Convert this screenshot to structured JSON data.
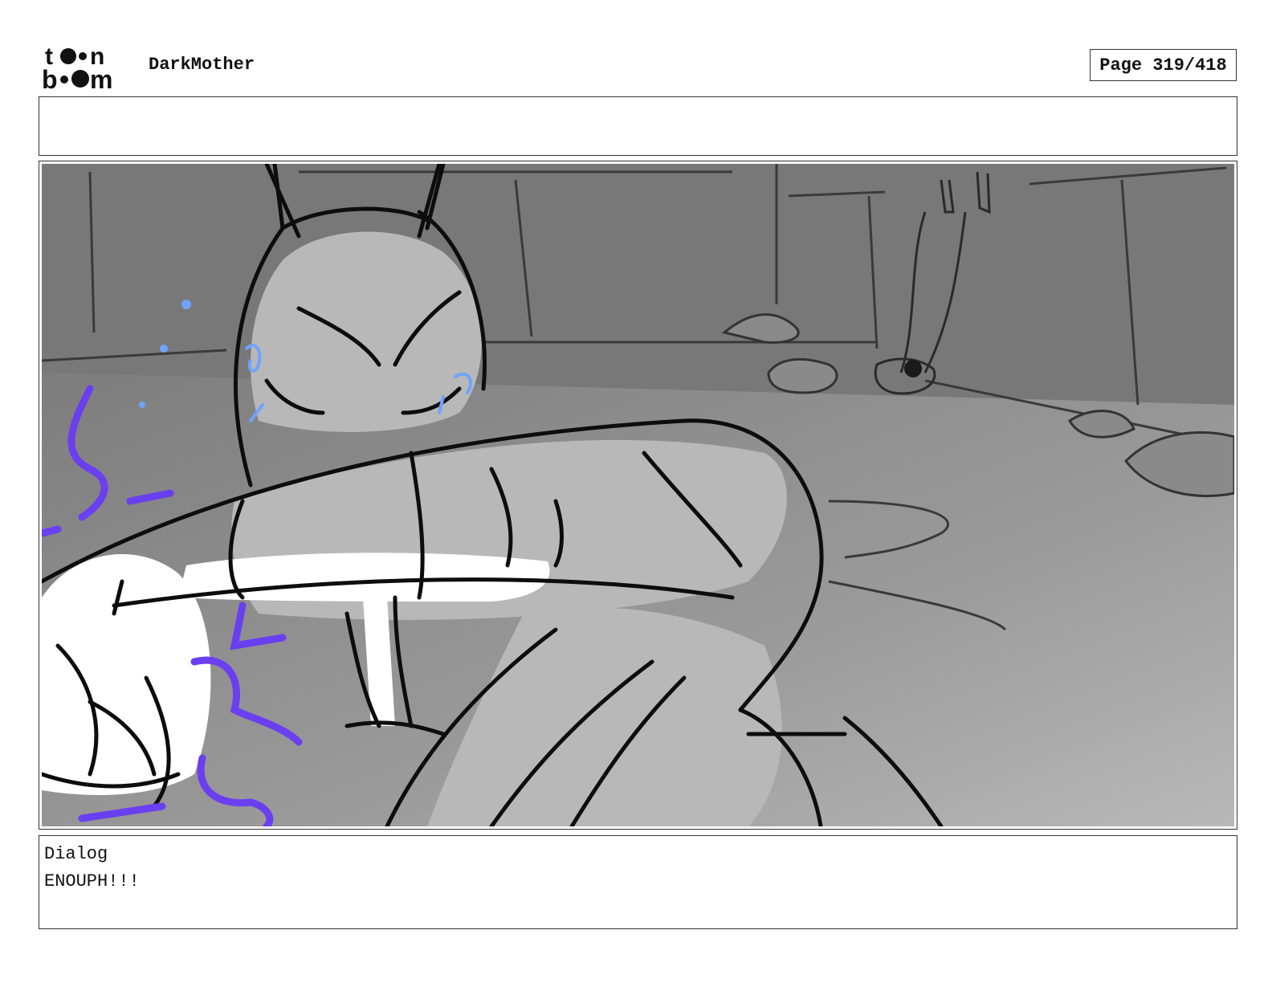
{
  "header": {
    "logo_text": "toon boom",
    "project_title": "DarkMother",
    "page_label": "Page 319/418"
  },
  "notes": {
    "text": ""
  },
  "panel": {
    "image_name": "storyboard-sketch"
  },
  "dialog": {
    "label": "Dialog",
    "text": "ENOUPH!!!"
  }
}
